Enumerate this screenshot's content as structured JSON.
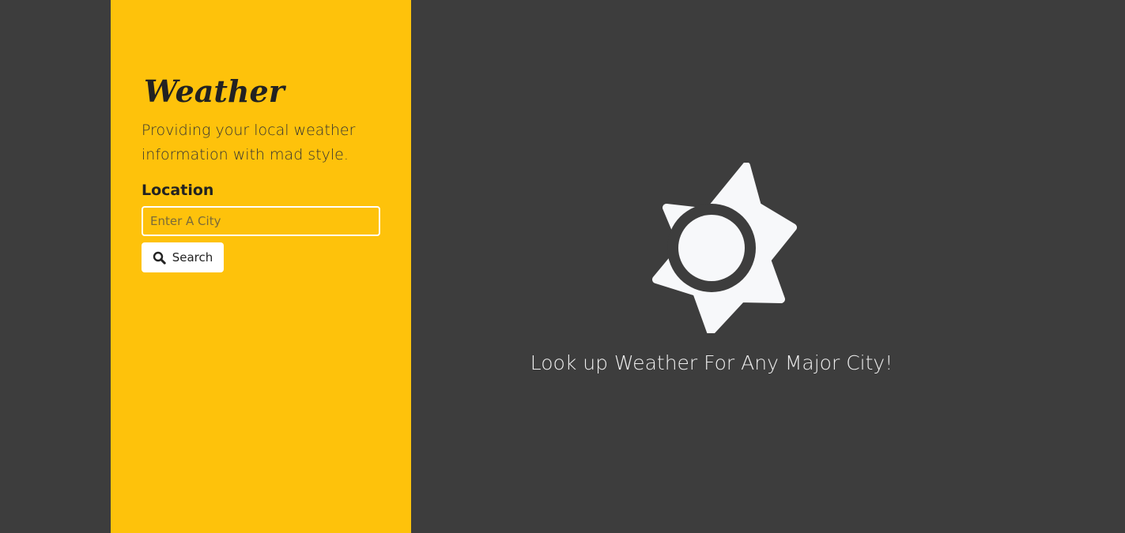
{
  "sidebar": {
    "title": "Weather",
    "tagline": "Providing your local weather information with mad style.",
    "location_label": "Location",
    "city_input": {
      "value": "",
      "placeholder": "Enter A City"
    },
    "search_button": {
      "label": "Search",
      "icon": "search-icon"
    }
  },
  "main": {
    "icon": "sun-icon",
    "prompt": "Look up Weather For Any Major City!"
  },
  "colors": {
    "background": "#3d3d3d",
    "sidebar": "#fec20b",
    "accent_text": "#222222",
    "icon": "#f7f8fa"
  }
}
